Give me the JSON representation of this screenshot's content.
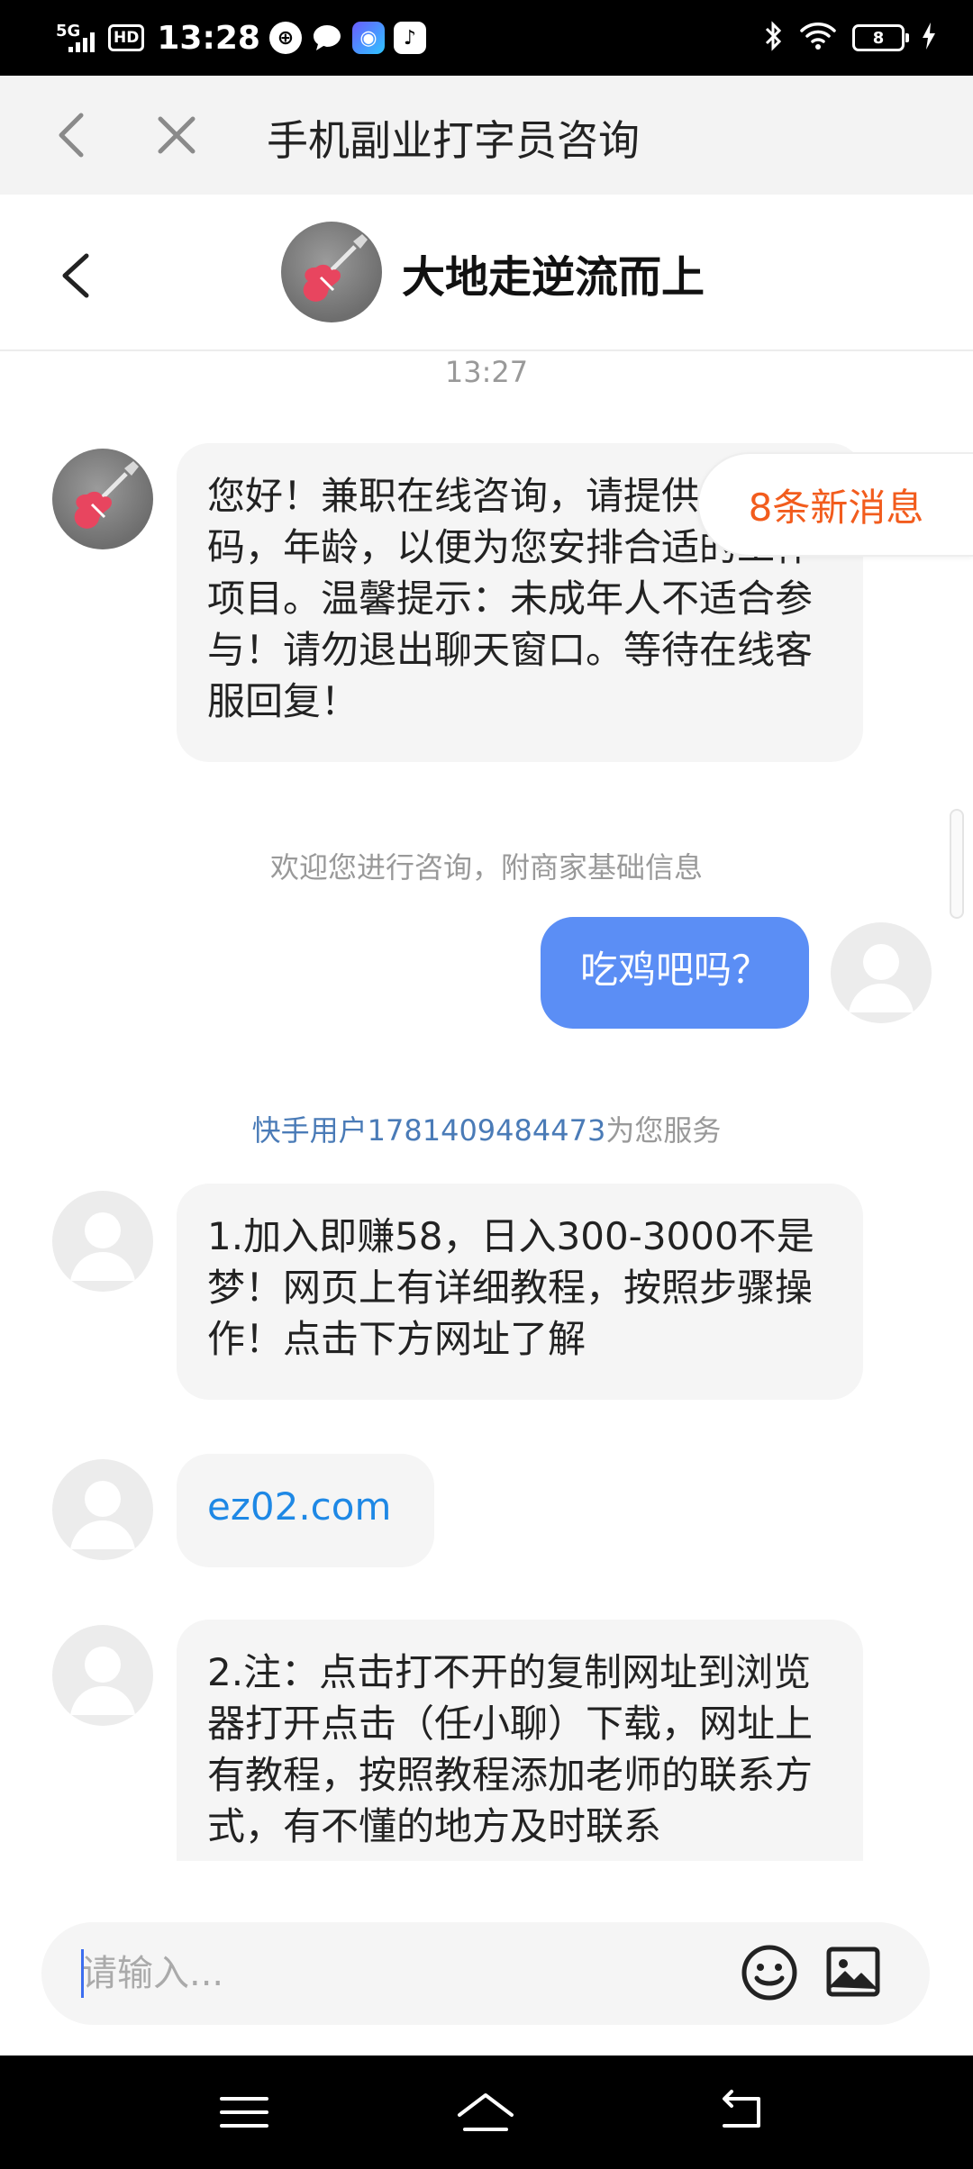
{
  "status_bar": {
    "network": "5G",
    "hd": "HD",
    "time": "13:28",
    "battery": "8",
    "icons": [
      "signal-icon",
      "hd-icon",
      "app-icon-1",
      "chat-bubble-icon",
      "camera-app-icon",
      "tiktok-icon",
      "bluetooth-icon",
      "wifi-icon",
      "battery-icon",
      "charging-icon"
    ]
  },
  "web_header": {
    "title": "手机副业打字员咨询",
    "back_icon": "chevron-left-icon",
    "close_icon": "close-icon"
  },
  "chat_header": {
    "name": "大地走逆流而上",
    "avatar": "guitar-avatar"
  },
  "messages": {
    "timestamp": "13:27",
    "msg1": "您好！兼职在线咨询，请提供手机号码，年龄，以便为您安排合适的工作项目。温馨提示：未成年人不适合参与！请勿退出聊天窗口。等待在线客服回复！",
    "system_note": "欢迎您进行咨询，附商家基础信息",
    "my_msg": "吃鸡吧吗？",
    "service_user": "快手用户1781409484473",
    "service_suffix": "为您服务",
    "msg2": "1.加入即赚58，日入300-3000不是梦！网页上有详细教程，按照步骤操作！点击下方网址了解",
    "msg3_link": "ez02.com",
    "msg4": "2.注：点击打不开的复制网址到浏览器打开点击（任小聊）下载，网址上有教程，按照教程添加老师的联系方式，有不懂的地方及时联系"
  },
  "new_messages_badge": "8条新消息",
  "input": {
    "placeholder": "请输入..."
  },
  "nav": {
    "icons": [
      "menu-icon",
      "home-icon",
      "back-icon"
    ]
  },
  "colors": {
    "accent": "#5b8ef5",
    "badge": "#f25c1d",
    "link": "#1e88e5",
    "service_name": "#4a7bb7"
  }
}
